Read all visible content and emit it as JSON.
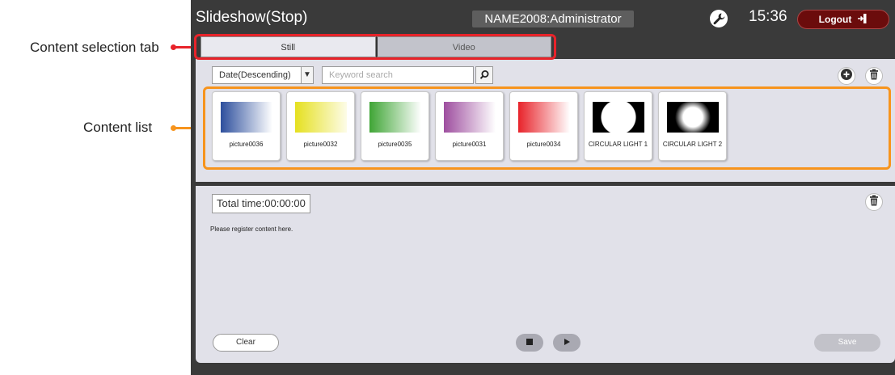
{
  "callouts": {
    "content_selection_tab": "Content selection tab",
    "content_list": "Content list",
    "tab_color": "#e8232a",
    "list_color": "#f7941d"
  },
  "header": {
    "title": "Slideshow(Stop)",
    "user": "NAME2008:Administrator",
    "time": "15:36",
    "logout_label": "Logout",
    "settings_icon": "wrench-icon",
    "logout_icon": "logout-icon"
  },
  "tabs": [
    {
      "label": "Still",
      "active": true
    },
    {
      "label": "Video",
      "active": false
    }
  ],
  "content": {
    "sort_value": "Date(Descending)",
    "search_placeholder": "Keyword search",
    "items": [
      {
        "label": "picture0036",
        "gradient": [
          "#2d4f9d",
          "#ffffff"
        ]
      },
      {
        "label": "picture0032",
        "gradient": [
          "#e5e01f",
          "#fdfce8"
        ]
      },
      {
        "label": "picture0035",
        "gradient": [
          "#3fa535",
          "#ffffff"
        ]
      },
      {
        "label": "picture0031",
        "gradient": [
          "#9e4e9f",
          "#ffffff"
        ]
      },
      {
        "label": "picture0034",
        "gradient": [
          "#e8232a",
          "#ffffff"
        ]
      },
      {
        "label": "CIRCULAR LIGHT 1",
        "kind": "circle-hard"
      },
      {
        "label": "CIRCULAR LIGHT 2",
        "kind": "circle-soft"
      }
    ]
  },
  "playlist": {
    "total_time": "Total time:00:00:00",
    "hint": "Please register content here.",
    "clear_label": "Clear",
    "save_label": "Save"
  }
}
